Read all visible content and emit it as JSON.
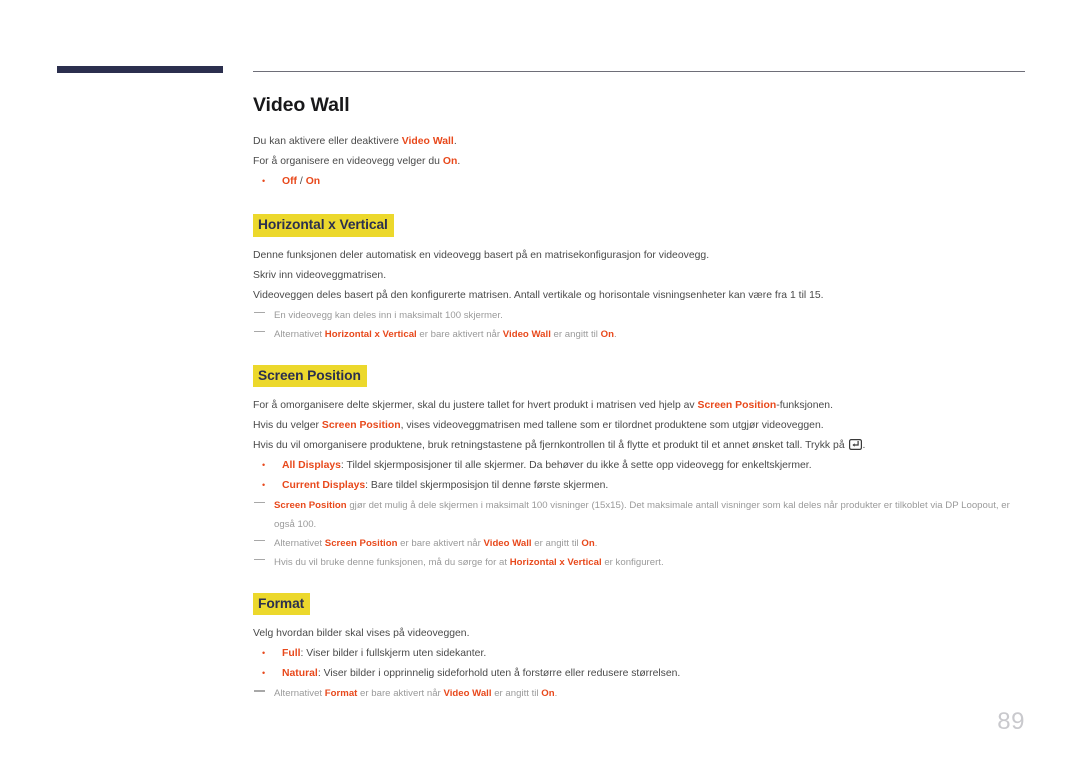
{
  "colors": {
    "accent_red": "#e8491c",
    "highlight_yellow": "#ecd82c",
    "heading_navy": "#2b2f4e",
    "note_gray": "#9a9a9a",
    "page_number_gray": "#c9c9cd"
  },
  "header": {
    "bar_name": "decorative-navy-bar",
    "rule_name": "decorative-header-rule"
  },
  "page": {
    "title": "Video Wall",
    "number": "89"
  },
  "sections": [
    {
      "id": "video-wall",
      "heading": "Video Wall",
      "heading_style": "page-title",
      "paragraphs": [
        {
          "parts": [
            {
              "t": "Du kan aktivere eller deaktivere ",
              "kw": false
            },
            {
              "t": "Video Wall",
              "kw": true
            },
            {
              "t": ".",
              "kw": false
            }
          ]
        },
        {
          "parts": [
            {
              "t": "For å organisere en videovegg velger du ",
              "kw": false
            },
            {
              "t": "On",
              "kw": true
            },
            {
              "t": ".",
              "kw": false
            }
          ]
        }
      ],
      "bullets": [
        {
          "parts": [
            {
              "t": "Off",
              "kw": true
            },
            {
              "t": " / ",
              "kw": false
            },
            {
              "t": "On",
              "kw": true
            }
          ]
        }
      ],
      "notes": []
    },
    {
      "id": "horizontal-x-vertical",
      "heading": "Horizontal x Vertical",
      "heading_style": "highlight",
      "paragraphs": [
        {
          "parts": [
            {
              "t": "Denne funksjonen deler automatisk en videovegg basert på en matrisekonfigurasjon for videovegg.",
              "kw": false
            }
          ]
        },
        {
          "parts": [
            {
              "t": "Skriv inn videoveggmatrisen.",
              "kw": false
            }
          ]
        },
        {
          "parts": [
            {
              "t": "Videoveggen deles basert på den konfigurerte matrisen. Antall vertikale og horisontale visningsenheter kan være fra 1 til 15.",
              "kw": false
            }
          ]
        }
      ],
      "bullets": [],
      "notes": [
        {
          "parts": [
            {
              "t": "En videovegg kan deles inn i maksimalt 100 skjermer.",
              "kw": false
            }
          ]
        },
        {
          "parts": [
            {
              "t": "Alternativet ",
              "kw": false
            },
            {
              "t": "Horizontal x Vertical",
              "kw": true
            },
            {
              "t": " er bare aktivert når ",
              "kw": false
            },
            {
              "t": "Video Wall",
              "kw": true
            },
            {
              "t": " er angitt til ",
              "kw": false
            },
            {
              "t": "On",
              "kw": true
            },
            {
              "t": ".",
              "kw": false
            }
          ]
        }
      ]
    },
    {
      "id": "screen-position",
      "heading": "Screen Position",
      "heading_style": "highlight",
      "paragraphs": [
        {
          "parts": [
            {
              "t": "For å omorganisere delte skjermer, skal du justere tallet for hvert produkt i matrisen ved hjelp av ",
              "kw": false
            },
            {
              "t": "Screen Position",
              "kw": true
            },
            {
              "t": "-funksjonen.",
              "kw": false
            }
          ]
        },
        {
          "parts": [
            {
              "t": "Hvis du velger ",
              "kw": false
            },
            {
              "t": "Screen Position",
              "kw": true
            },
            {
              "t": ", vises videoveggmatrisen med tallene som er tilordnet produktene som utgjør videoveggen.",
              "kw": false
            }
          ]
        },
        {
          "parts": [
            {
              "t": "Hvis du vil omorganisere produktene, bruk retningstastene på fjernkontrollen til å flytte et produkt til et annet ønsket tall. Trykk på ",
              "kw": false
            },
            {
              "t": "",
              "kw": false,
              "icon": "enter-key-icon"
            },
            {
              "t": ".",
              "kw": false
            }
          ]
        }
      ],
      "bullets": [
        {
          "parts": [
            {
              "t": "All Displays",
              "kw": true
            },
            {
              "t": ": Tildel skjermposisjoner til alle skjermer. Da behøver du ikke å sette opp videovegg for enkeltskjermer.",
              "kw": false
            }
          ]
        },
        {
          "parts": [
            {
              "t": "Current Displays",
              "kw": true
            },
            {
              "t": ": Bare tildel skjermposisjon til denne første skjermen.",
              "kw": false
            }
          ]
        }
      ],
      "notes": [
        {
          "parts": [
            {
              "t": "Screen Position",
              "kw": true
            },
            {
              "t": " gjør det mulig å dele skjermen i maksimalt 100 visninger (15x15). Det maksimale antall visninger som kal deles når produkter er tilkoblet via DP Loopout, er også 100.",
              "kw": false
            }
          ]
        },
        {
          "parts": [
            {
              "t": "Alternativet ",
              "kw": false
            },
            {
              "t": "Screen Position",
              "kw": true
            },
            {
              "t": " er bare aktivert når ",
              "kw": false
            },
            {
              "t": "Video Wall",
              "kw": true
            },
            {
              "t": " er angitt til ",
              "kw": false
            },
            {
              "t": "On",
              "kw": true
            },
            {
              "t": ".",
              "kw": false
            }
          ]
        },
        {
          "parts": [
            {
              "t": "Hvis du vil bruke denne funksjonen, må du sørge for at ",
              "kw": false
            },
            {
              "t": "Horizontal x Vertical",
              "kw": true
            },
            {
              "t": " er konfigurert.",
              "kw": false
            }
          ]
        }
      ]
    },
    {
      "id": "format",
      "heading": "Format",
      "heading_style": "highlight",
      "paragraphs": [
        {
          "parts": [
            {
              "t": "Velg hvordan bilder skal vises på videoveggen.",
              "kw": false
            }
          ]
        }
      ],
      "bullets": [
        {
          "parts": [
            {
              "t": "Full",
              "kw": true
            },
            {
              "t": ": Viser bilder i fullskjerm uten sidekanter.",
              "kw": false
            }
          ]
        },
        {
          "parts": [
            {
              "t": "Natural",
              "kw": true
            },
            {
              "t": ": Viser bilder i opprinnelig sideforhold uten å forstørre eller redusere størrelsen.",
              "kw": false
            }
          ]
        }
      ],
      "notes": [
        {
          "parts": [
            {
              "t": "Alternativet ",
              "kw": false
            },
            {
              "t": "Format",
              "kw": true
            },
            {
              "t": " er bare aktivert når ",
              "kw": false
            },
            {
              "t": "Video Wall",
              "kw": true
            },
            {
              "t": " er angitt til ",
              "kw": false
            },
            {
              "t": "On",
              "kw": true
            },
            {
              "t": ".",
              "kw": false
            }
          ]
        }
      ]
    }
  ]
}
